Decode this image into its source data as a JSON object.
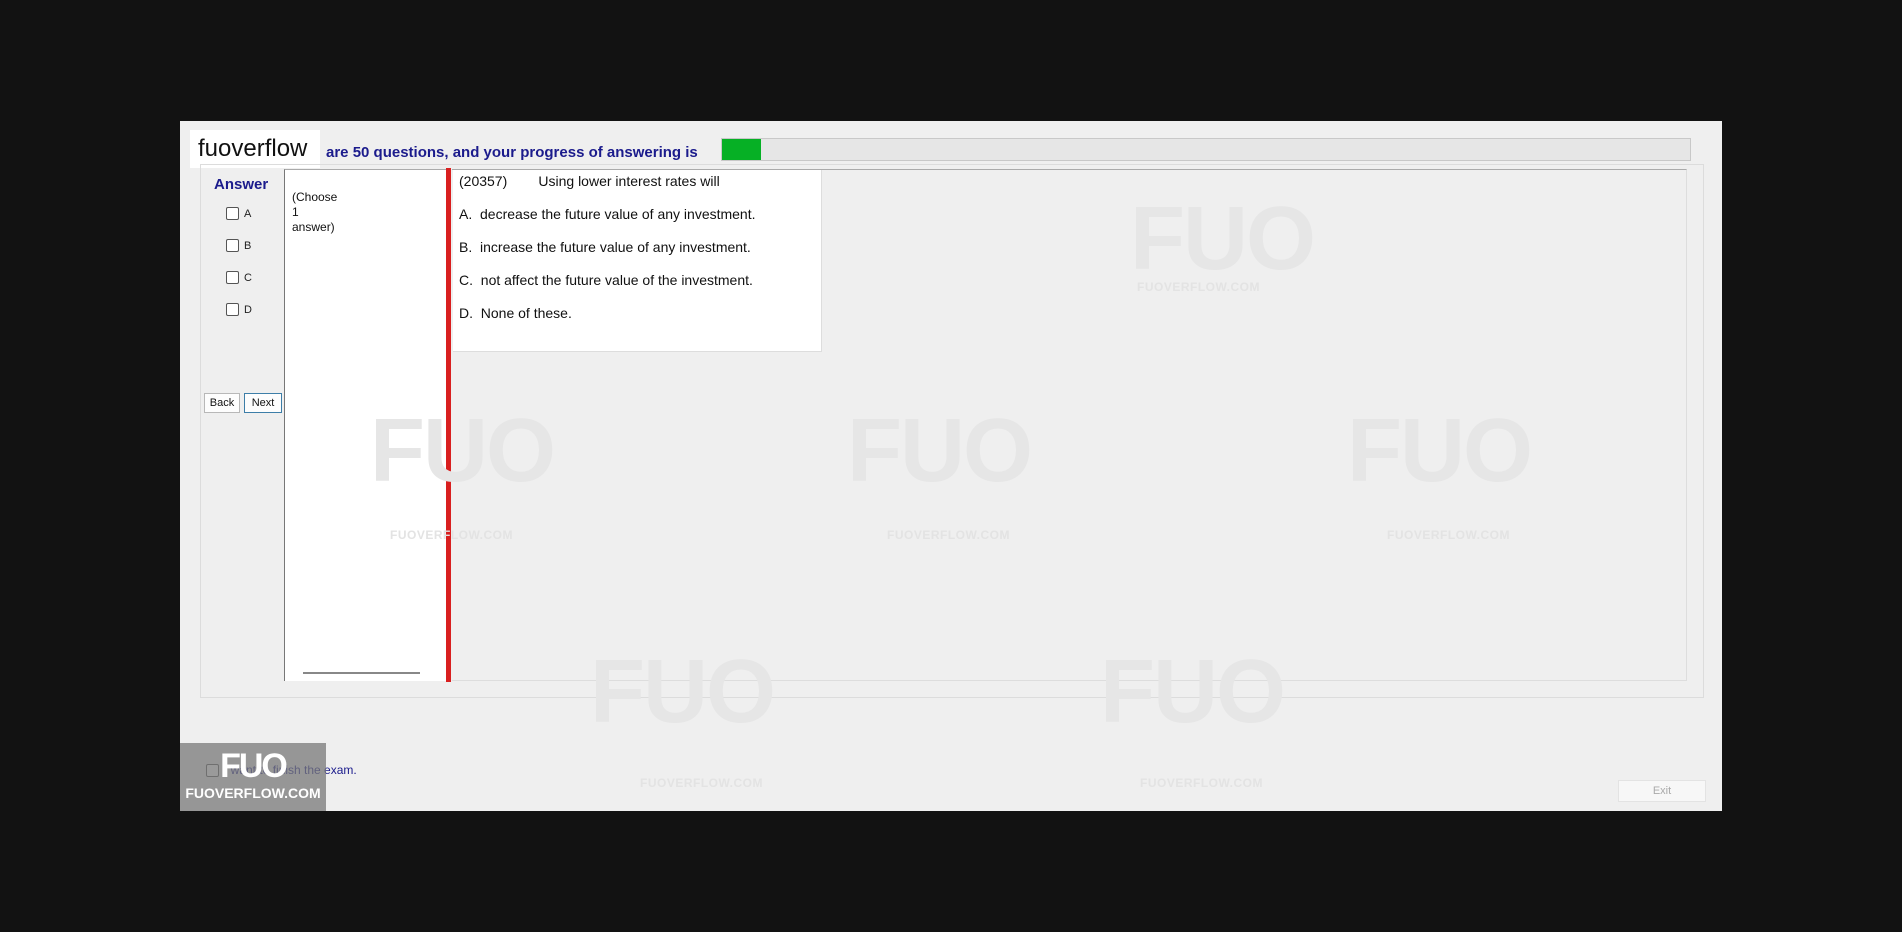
{
  "header": {
    "logo_text": "fuoverflow",
    "progress_text": "are 50 questions, and your progress of answering is",
    "progress_fraction": 0.04
  },
  "answer_panel": {
    "title": "Answer",
    "options": [
      "A",
      "B",
      "C",
      "D"
    ],
    "back_label": "Back",
    "next_label": "Next"
  },
  "choose": {
    "line1": "(Choose",
    "line2": "1",
    "line3": "answer)"
  },
  "question": {
    "id": "(20357)",
    "text": "Using lower interest rates will",
    "choices": [
      "A.  decrease the future value of any investment.",
      "B.  increase the future value of any investment.",
      "C.  not affect the future value of the investment.",
      "D.  None of these."
    ]
  },
  "footer": {
    "finish_label": "I want to finish the exam.",
    "exit_label": "Exit",
    "brand_mark": "FUO",
    "brand_url": "FUOVERFLOW.COM"
  },
  "watermark": {
    "text": "FUOVERFLOW.COM",
    "mark": "FUO"
  },
  "colors": {
    "progress_fill": "#06b025",
    "divider": "#d91f1f",
    "heading_blue": "#1b1b8c"
  }
}
